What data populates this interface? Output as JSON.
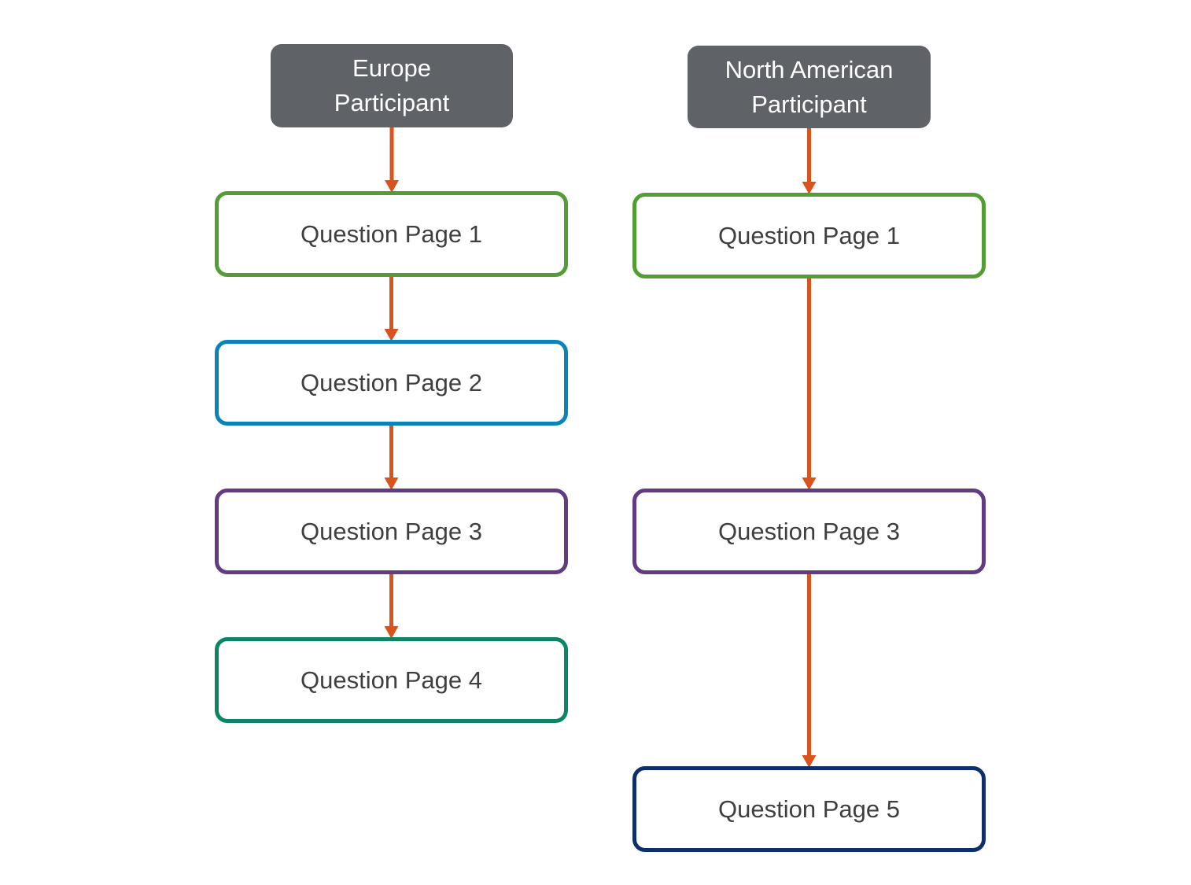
{
  "diagram": {
    "arrow_color": "#d9531e",
    "columns": [
      {
        "id": "europe",
        "header": {
          "label": "Europe\nParticipant",
          "color": "#5f6266"
        },
        "pages": [
          {
            "label": "Question Page 1",
            "border_color": "#539e34"
          },
          {
            "label": "Question Page 2",
            "border_color": "#0a84b8"
          },
          {
            "label": "Question Page 3",
            "border_color": "#623b83"
          },
          {
            "label": "Question Page 4",
            "border_color": "#0b8566"
          }
        ]
      },
      {
        "id": "north-america",
        "header": {
          "label": "North American\nParticipant",
          "color": "#5f6266"
        },
        "pages": [
          {
            "label": "Question Page 1",
            "border_color": "#539e34"
          },
          {
            "label": "Question Page 3",
            "border_color": "#623b83"
          },
          {
            "label": "Question Page 5",
            "border_color": "#0d2f6c"
          }
        ]
      }
    ],
    "edges": [
      {
        "from": "europe.header",
        "to": "europe.pages.0"
      },
      {
        "from": "europe.pages.0",
        "to": "europe.pages.1"
      },
      {
        "from": "europe.pages.1",
        "to": "europe.pages.2"
      },
      {
        "from": "europe.pages.2",
        "to": "europe.pages.3"
      },
      {
        "from": "north-america.header",
        "to": "north-america.pages.0"
      },
      {
        "from": "north-america.pages.0",
        "to": "north-america.pages.1"
      },
      {
        "from": "north-america.pages.1",
        "to": "north-america.pages.2"
      }
    ]
  }
}
